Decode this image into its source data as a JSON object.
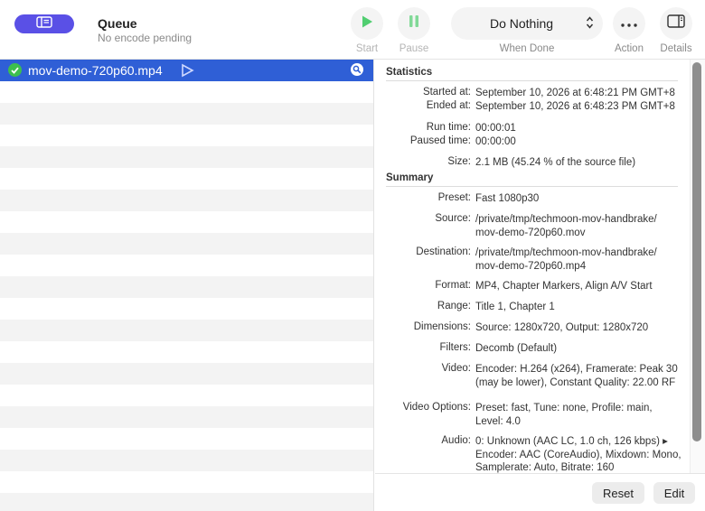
{
  "toolbar": {
    "title": "Queue",
    "subtitle": "No encode pending",
    "start_label": "Start",
    "pause_label": "Pause",
    "when_done_value": "Do Nothing",
    "when_done_label": "When Done",
    "action_label": "Action",
    "details_label": "Details"
  },
  "queue": {
    "jobs": [
      {
        "name": "mov-demo-720p60.mp4",
        "status": "completed"
      }
    ]
  },
  "details": {
    "statistics_heading": "Statistics",
    "started_label": "Started at:",
    "started_value": "September 10, 2026 at 6:48:21 PM GMT+8",
    "ended_label": "Ended at:",
    "ended_value": "September 10, 2026 at 6:48:23 PM GMT+8",
    "runtime_label": "Run time:",
    "runtime_value": "00:00:01",
    "paused_label": "Paused time:",
    "paused_value": "00:00:00",
    "size_label": "Size:",
    "size_value": "2.1 MB (45.24 % of the source file)",
    "summary_heading": "Summary",
    "preset_label": "Preset:",
    "preset_value": "Fast 1080p30",
    "source_label": "Source:",
    "source_value": "/private/tmp/techmoon-mov-handbrake/ mov-demo-720p60.mov",
    "destination_label": "Destination:",
    "destination_value": "/private/tmp/techmoon-mov-handbrake/ mov-demo-720p60.mp4",
    "format_label": "Format:",
    "format_value": "MP4, Chapter Markers, Align A/V Start",
    "range_label": "Range:",
    "range_value": "Title 1, Chapter 1",
    "dimensions_label": "Dimensions:",
    "dimensions_value": "Source: 1280x720, Output: 1280x720",
    "filters_label": "Filters:",
    "filters_value": "Decomb (Default)",
    "video_label": "Video:",
    "video_value": "Encoder: H.264 (x264), Framerate: Peak 30 (may be lower), Constant Quality: 22.00 RF",
    "video_options_label": "Video Options:",
    "video_options_value": "Preset: fast, Tune: none, Profile: main, Level: 4.0",
    "audio_label": "Audio:",
    "audio_value": "0: Unknown (AAC LC, 1.0 ch, 126 kbps) ▸ Encoder: AAC (CoreAudio), Mixdown: Mono, Samplerate: Auto, Bitrate: 160"
  },
  "footer": {
    "reset_label": "Reset",
    "edit_label": "Edit"
  },
  "icons": {
    "start": "play-icon",
    "pause": "pause-icon",
    "action": "ellipsis-icon",
    "details": "sidebar-right-icon",
    "sidebar_toggle": "sidebar-left-icon",
    "job_status": "checkmark-icon",
    "job_reveal": "magnifier-icon"
  },
  "colors": {
    "accent": "#5a50e6",
    "selection": "#2f5fd6",
    "success": "#3dbf4e",
    "start_green": "#34c759"
  }
}
